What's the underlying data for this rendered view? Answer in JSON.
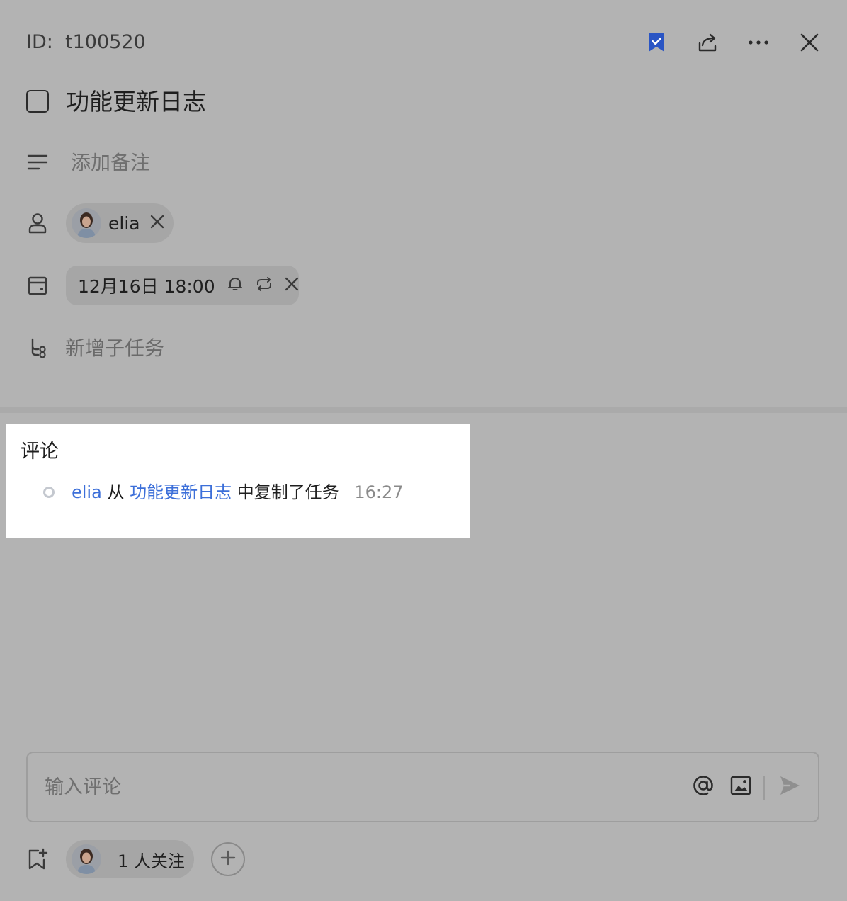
{
  "header": {
    "id_label": "ID:  t100520",
    "icons": [
      "bookmark-check-icon",
      "share-icon",
      "more-icon",
      "close-icon"
    ],
    "bookmark_color": "#2a55c4"
  },
  "task": {
    "title": "功能更新日志",
    "completed": false
  },
  "note": {
    "placeholder": "添加备注"
  },
  "assignee": {
    "name": "elia"
  },
  "due": {
    "text": "12月16日 18:00"
  },
  "subtask": {
    "label": "新增子任务"
  },
  "comments": {
    "heading": "评论",
    "activity": {
      "user": "elia",
      "from_word": "从",
      "source_task": "功能更新日志",
      "action": "中复制了任务",
      "time": "16:27"
    }
  },
  "comment_input": {
    "placeholder": "输入评论"
  },
  "followers": {
    "label": "1 人关注"
  },
  "colors": {
    "overlay": "#b3b3b3",
    "link": "#3c6fd9",
    "panel": "#ffffff"
  }
}
